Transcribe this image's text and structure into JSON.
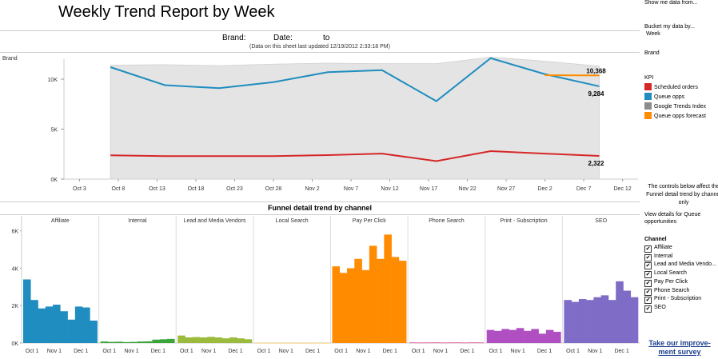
{
  "title": "Weekly Trend Report by Week",
  "filter_bar": {
    "brand_label": "Brand:",
    "date_label": "Date:",
    "to_label": "to",
    "note": "(Data on this sheet last updated 12/19/2012 2:33:18 PM)"
  },
  "right_panel": {
    "show_me": "Show me data from...",
    "bucket": "Bucket my data by...",
    "bucket_value": "Week",
    "brand": "Brand",
    "kpi_title": "KPI",
    "kpi_items": [
      {
        "label": "Scheduled orders",
        "color": "#d62728"
      },
      {
        "label": "Queue opps",
        "color": "#1f8dbf"
      },
      {
        "label": "Google Trends Index",
        "color": "#8c8c8c"
      },
      {
        "label": "Queue opps forecast",
        "color": "#ff8c00"
      }
    ],
    "controls_note": "The controls below affect the Funnel detail trend by channel only",
    "view_details": "View details for Queue opportunities",
    "channel_title": "Channel",
    "channels": [
      "Affiliate",
      "Internal",
      "Lead and Media Vendo...",
      "Local Search",
      "Pay Per Click",
      "Phone Search",
      "Print - Subscription",
      "SEO"
    ],
    "survey": "Take our improve-ment survey"
  },
  "chart_data": [
    {
      "type": "line",
      "pane_label": "Brand",
      "x_ticks": [
        "Oct 3",
        "Oct 8",
        "Oct 13",
        "Oct 18",
        "Oct 23",
        "Oct 28",
        "Nov 2",
        "Nov 7",
        "Nov 12",
        "Nov 17",
        "Nov 22",
        "Nov 27",
        "Dec 2",
        "Dec 7",
        "Dec 12"
      ],
      "y_ticks": [
        "0K",
        "5K",
        "10K"
      ],
      "ylim": [
        0,
        12000
      ],
      "x": [
        "Oct 7",
        "Oct 14",
        "Oct 21",
        "Oct 28",
        "Nov 4",
        "Nov 11",
        "Nov 18",
        "Nov 25",
        "Dec 2",
        "Dec 9"
      ],
      "series": [
        {
          "name": "Google Trends Index",
          "color": "#8c8c8c",
          "values": [
            11400,
            11450,
            11350,
            11500,
            11600,
            11550,
            11550,
            12200,
            11800,
            11300
          ]
        },
        {
          "name": "Queue opps",
          "color": "#1f8dbf",
          "values": [
            11200,
            9400,
            9100,
            9700,
            10700,
            10900,
            7800,
            12100,
            10500,
            9284
          ],
          "end_label": "9,284"
        },
        {
          "name": "Scheduled orders",
          "color": "#d62728",
          "values": [
            2380,
            2300,
            2300,
            2300,
            2400,
            2550,
            1800,
            2800,
            2550,
            2322
          ],
          "end_label": "2,322"
        },
        {
          "name": "Queue opps forecast",
          "color": "#ff8c00",
          "x": [
            "Dec 2",
            "Dec 9"
          ],
          "values": [
            10400,
            10368
          ],
          "end_label": "10,368"
        }
      ]
    },
    {
      "type": "bar",
      "title": "Funnel detail trend by channel",
      "y_ticks": [
        "0K",
        "2K",
        "4K",
        "6K"
      ],
      "ylim": [
        0,
        6200
      ],
      "x_ticks": [
        "Oct 1",
        "Nov 1",
        "Dec 1"
      ],
      "series": [
        {
          "name": "Affiliate",
          "color": "#1f8dbf",
          "values": [
            3400,
            2300,
            1850,
            1950,
            2050,
            1700,
            1250,
            1950,
            1900,
            1200
          ]
        },
        {
          "name": "Internal",
          "color": "#3aa63a",
          "values": [
            80,
            60,
            70,
            50,
            60,
            80,
            90,
            180,
            200,
            220
          ]
        },
        {
          "name": "Lead and Media Vendors",
          "color": "#9bbb3d",
          "values": [
            400,
            300,
            320,
            300,
            330,
            300,
            250,
            300,
            250,
            200
          ]
        },
        {
          "name": "Local Search",
          "color": "#f2c75c",
          "values": [
            15,
            10,
            12,
            10,
            12,
            10,
            8,
            12,
            15,
            10
          ]
        },
        {
          "name": "Pay Per Click",
          "color": "#ff8c00",
          "values": [
            4100,
            3750,
            4000,
            4500,
            3900,
            5200,
            4500,
            5800,
            4600,
            4400
          ]
        },
        {
          "name": "Phone Search",
          "color": "#d64b8c",
          "values": [
            30,
            25,
            28,
            30,
            25,
            28,
            30,
            25,
            30,
            28
          ]
        },
        {
          "name": "Print - Subscription",
          "color": "#b04fc2",
          "values": [
            700,
            650,
            750,
            700,
            800,
            650,
            750,
            500,
            700,
            600
          ]
        },
        {
          "name": "SEO",
          "color": "#7e6cc6",
          "values": [
            2300,
            2200,
            2350,
            2300,
            2450,
            2550,
            2300,
            3300,
            2800,
            2450
          ]
        }
      ]
    }
  ]
}
